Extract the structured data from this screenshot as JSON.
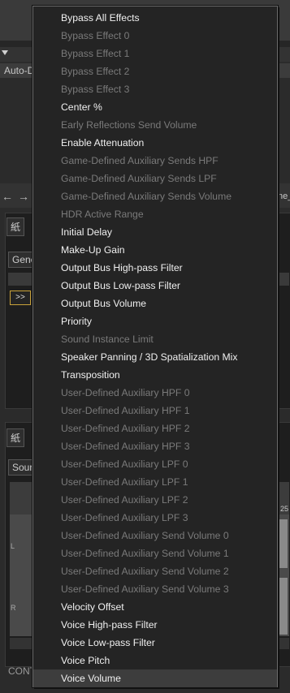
{
  "background": {
    "auto_label": "Auto-D",
    "panel1_tab": "紙",
    "panel1_tab2": "Gene",
    "forward_button": ">>",
    "panel2_tab": "紙",
    "panel2_subtab": "Sour",
    "channel_l": "L",
    "channel_r": "R",
    "ruler_value": "25",
    "bottom_label": "CONT",
    "right_fragment": "ne_"
  },
  "menu": {
    "items": [
      {
        "label": "Bypass All Effects",
        "enabled": true
      },
      {
        "label": "Bypass Effect 0",
        "enabled": false
      },
      {
        "label": "Bypass Effect 1",
        "enabled": false
      },
      {
        "label": "Bypass Effect 2",
        "enabled": false
      },
      {
        "label": "Bypass Effect 3",
        "enabled": false
      },
      {
        "label": "Center %",
        "enabled": true
      },
      {
        "label": "Early Reflections Send Volume",
        "enabled": false
      },
      {
        "label": "Enable Attenuation",
        "enabled": true
      },
      {
        "label": "Game-Defined Auxiliary Sends HPF",
        "enabled": false
      },
      {
        "label": "Game-Defined Auxiliary Sends LPF",
        "enabled": false
      },
      {
        "label": "Game-Defined Auxiliary Sends Volume",
        "enabled": false
      },
      {
        "label": "HDR Active Range",
        "enabled": false
      },
      {
        "label": "Initial Delay",
        "enabled": true
      },
      {
        "label": "Make-Up Gain",
        "enabled": true
      },
      {
        "label": "Output Bus High-pass Filter",
        "enabled": true
      },
      {
        "label": "Output Bus Low-pass Filter",
        "enabled": true
      },
      {
        "label": "Output Bus Volume",
        "enabled": true
      },
      {
        "label": "Priority",
        "enabled": true
      },
      {
        "label": "Sound Instance Limit",
        "enabled": false
      },
      {
        "label": "Speaker Panning / 3D Spatialization Mix",
        "enabled": true
      },
      {
        "label": "Transposition",
        "enabled": true
      },
      {
        "label": "User-Defined Auxiliary HPF 0",
        "enabled": false
      },
      {
        "label": "User-Defined Auxiliary HPF 1",
        "enabled": false
      },
      {
        "label": "User-Defined Auxiliary HPF 2",
        "enabled": false
      },
      {
        "label": "User-Defined Auxiliary HPF 3",
        "enabled": false
      },
      {
        "label": "User-Defined Auxiliary LPF 0",
        "enabled": false
      },
      {
        "label": "User-Defined Auxiliary LPF 1",
        "enabled": false
      },
      {
        "label": "User-Defined Auxiliary LPF 2",
        "enabled": false
      },
      {
        "label": "User-Defined Auxiliary LPF 3",
        "enabled": false
      },
      {
        "label": "User-Defined Auxiliary Send Volume 0",
        "enabled": false
      },
      {
        "label": "User-Defined Auxiliary Send Volume 1",
        "enabled": false
      },
      {
        "label": "User-Defined Auxiliary Send Volume 2",
        "enabled": false
      },
      {
        "label": "User-Defined Auxiliary Send Volume 3",
        "enabled": false
      },
      {
        "label": "Velocity Offset",
        "enabled": true
      },
      {
        "label": "Voice High-pass Filter",
        "enabled": true
      },
      {
        "label": "Voice Low-pass Filter",
        "enabled": true
      },
      {
        "label": "Voice Pitch",
        "enabled": true
      },
      {
        "label": "Voice Volume",
        "enabled": true,
        "selected": true
      }
    ]
  },
  "colors": {
    "menu_bg": "#242424",
    "enabled_text": "#f0f0f0",
    "disabled_text": "#7a7a7a",
    "selected_bg": "#3d3d3d",
    "accent": "#c9a23a"
  }
}
